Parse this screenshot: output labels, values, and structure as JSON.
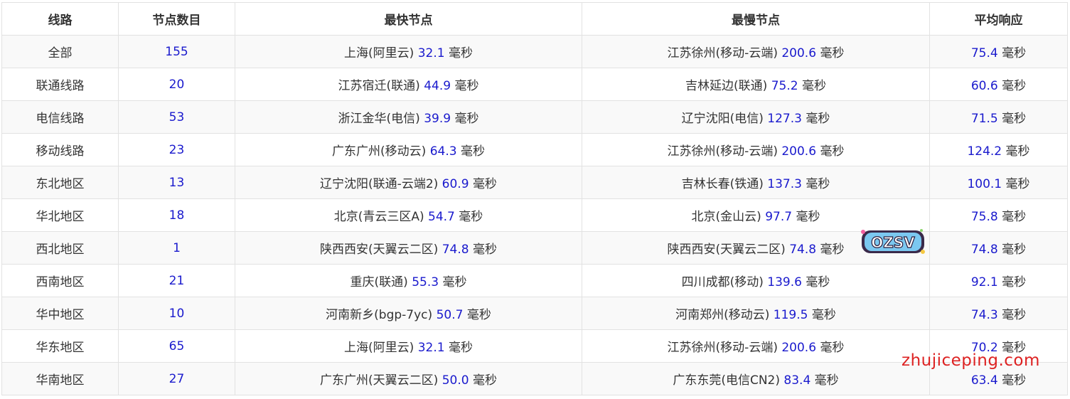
{
  "table": {
    "headers": [
      "线路",
      "节点数目",
      "最快节点",
      "最慢节点",
      "平均响应"
    ],
    "unit": "毫秒",
    "rows": [
      {
        "route": "全部",
        "count": "155",
        "fast_place": "上海(阿里云)",
        "fast_ms": "32.1",
        "slow_place": "江苏徐州(移动-云端)",
        "slow_ms": "200.6",
        "avg_ms": "75.4"
      },
      {
        "route": "联通线路",
        "count": "20",
        "fast_place": "江苏宿迁(联通)",
        "fast_ms": "44.9",
        "slow_place": "吉林延边(联通)",
        "slow_ms": "75.2",
        "avg_ms": "60.6"
      },
      {
        "route": "电信线路",
        "count": "53",
        "fast_place": "浙江金华(电信)",
        "fast_ms": "39.9",
        "slow_place": "辽宁沈阳(电信)",
        "slow_ms": "127.3",
        "avg_ms": "71.5"
      },
      {
        "route": "移动线路",
        "count": "23",
        "fast_place": "广东广州(移动云)",
        "fast_ms": "64.3",
        "slow_place": "江苏徐州(移动-云端)",
        "slow_ms": "200.6",
        "avg_ms": "124.2"
      },
      {
        "route": "东北地区",
        "count": "13",
        "fast_place": "辽宁沈阳(联通-云端2)",
        "fast_ms": "60.9",
        "slow_place": "吉林长春(铁通)",
        "slow_ms": "137.3",
        "avg_ms": "100.1"
      },
      {
        "route": "华北地区",
        "count": "18",
        "fast_place": "北京(青云三区A)",
        "fast_ms": "54.7",
        "slow_place": "北京(金山云)",
        "slow_ms": "97.7",
        "avg_ms": "75.8"
      },
      {
        "route": "西北地区",
        "count": "1",
        "fast_place": "陕西西安(天翼云二区)",
        "fast_ms": "74.8",
        "slow_place": "陕西西安(天翼云二区)",
        "slow_ms": "74.8",
        "avg_ms": "74.8"
      },
      {
        "route": "西南地区",
        "count": "21",
        "fast_place": "重庆(联通)",
        "fast_ms": "55.3",
        "slow_place": "四川成都(移动)",
        "slow_ms": "139.6",
        "avg_ms": "92.1"
      },
      {
        "route": "华中地区",
        "count": "10",
        "fast_place": "河南新乡(bgp-7yc)",
        "fast_ms": "50.7",
        "slow_place": "河南郑州(移动云)",
        "slow_ms": "119.5",
        "avg_ms": "74.3"
      },
      {
        "route": "华东地区",
        "count": "65",
        "fast_place": "上海(阿里云)",
        "fast_ms": "32.1",
        "slow_place": "江苏徐州(移动-云端)",
        "slow_ms": "200.6",
        "avg_ms": "70.2"
      },
      {
        "route": "华南地区",
        "count": "27",
        "fast_place": "广东广州(天翼云二区)",
        "fast_ms": "50.0",
        "slow_place": "广东东莞(电信CN2)",
        "slow_ms": "83.4",
        "avg_ms": "63.4"
      }
    ]
  },
  "watermark": {
    "site": "zhujiceping.com",
    "logo_text": "OZSV"
  },
  "colors": {
    "number": "#1a1acd",
    "text": "#333333",
    "border": "#e2e2e2",
    "stripe": "#f9f9f9",
    "watermark": "#dd2222"
  }
}
